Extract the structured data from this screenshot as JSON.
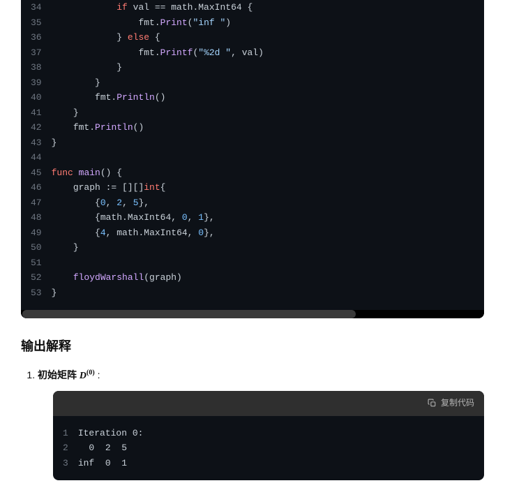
{
  "codeBlock1": {
    "startLine": 34,
    "lines": [
      {
        "i": "            ",
        "seg": [
          {
            "t": "if",
            "c": "kw"
          },
          {
            "t": " val == math.MaxInt64 {",
            "c": "ident"
          }
        ]
      },
      {
        "i": "                ",
        "seg": [
          {
            "t": "fmt.",
            "c": "ident"
          },
          {
            "t": "Print",
            "c": "fn"
          },
          {
            "t": "(",
            "c": "punct"
          },
          {
            "t": "\"inf \"",
            "c": "str"
          },
          {
            "t": ")",
            "c": "punct"
          }
        ]
      },
      {
        "i": "            ",
        "seg": [
          {
            "t": "} ",
            "c": "ident"
          },
          {
            "t": "else",
            "c": "kw"
          },
          {
            "t": " {",
            "c": "ident"
          }
        ]
      },
      {
        "i": "                ",
        "seg": [
          {
            "t": "fmt.",
            "c": "ident"
          },
          {
            "t": "Printf",
            "c": "fn"
          },
          {
            "t": "(",
            "c": "punct"
          },
          {
            "t": "\"%2d \"",
            "c": "str"
          },
          {
            "t": ", val)",
            "c": "ident"
          }
        ]
      },
      {
        "i": "            ",
        "seg": [
          {
            "t": "}",
            "c": "ident"
          }
        ]
      },
      {
        "i": "        ",
        "seg": [
          {
            "t": "}",
            "c": "ident"
          }
        ]
      },
      {
        "i": "        ",
        "seg": [
          {
            "t": "fmt.",
            "c": "ident"
          },
          {
            "t": "Println",
            "c": "fn"
          },
          {
            "t": "()",
            "c": "punct"
          }
        ]
      },
      {
        "i": "    ",
        "seg": [
          {
            "t": "}",
            "c": "ident"
          }
        ]
      },
      {
        "i": "    ",
        "seg": [
          {
            "t": "fmt.",
            "c": "ident"
          },
          {
            "t": "Println",
            "c": "fn"
          },
          {
            "t": "()",
            "c": "punct"
          }
        ]
      },
      {
        "i": "",
        "seg": [
          {
            "t": "}",
            "c": "ident"
          }
        ]
      },
      {
        "i": "",
        "seg": []
      },
      {
        "i": "",
        "seg": [
          {
            "t": "func",
            "c": "kw"
          },
          {
            "t": " ",
            "c": "ident"
          },
          {
            "t": "main",
            "c": "fn"
          },
          {
            "t": "() {",
            "c": "punct"
          }
        ]
      },
      {
        "i": "    ",
        "seg": [
          {
            "t": "graph := [][]",
            "c": "ident"
          },
          {
            "t": "int",
            "c": "type"
          },
          {
            "t": "{",
            "c": "punct"
          }
        ]
      },
      {
        "i": "        ",
        "seg": [
          {
            "t": "{",
            "c": "punct"
          },
          {
            "t": "0",
            "c": "num"
          },
          {
            "t": ", ",
            "c": "punct"
          },
          {
            "t": "2",
            "c": "num"
          },
          {
            "t": ", ",
            "c": "punct"
          },
          {
            "t": "5",
            "c": "num"
          },
          {
            "t": "},",
            "c": "punct"
          }
        ]
      },
      {
        "i": "        ",
        "seg": [
          {
            "t": "{math.MaxInt64, ",
            "c": "ident"
          },
          {
            "t": "0",
            "c": "num"
          },
          {
            "t": ", ",
            "c": "punct"
          },
          {
            "t": "1",
            "c": "num"
          },
          {
            "t": "},",
            "c": "punct"
          }
        ]
      },
      {
        "i": "        ",
        "seg": [
          {
            "t": "{",
            "c": "punct"
          },
          {
            "t": "4",
            "c": "num"
          },
          {
            "t": ", math.MaxInt64, ",
            "c": "ident"
          },
          {
            "t": "0",
            "c": "num"
          },
          {
            "t": "},",
            "c": "punct"
          }
        ]
      },
      {
        "i": "    ",
        "seg": [
          {
            "t": "}",
            "c": "ident"
          }
        ]
      },
      {
        "i": "",
        "seg": []
      },
      {
        "i": "    ",
        "seg": [
          {
            "t": "floydWarshall",
            "c": "fn"
          },
          {
            "t": "(graph)",
            "c": "ident"
          }
        ]
      },
      {
        "i": "",
        "seg": [
          {
            "t": "}",
            "c": "ident"
          }
        ]
      }
    ]
  },
  "sectionTitle": "输出解释",
  "listItem1": {
    "prefix": "初始矩阵 ",
    "math": "D",
    "mathSup": "(0)",
    "suffix": ":"
  },
  "copyLabel": "复制代码",
  "codeBlock2": {
    "startLine": 1,
    "lines": [
      {
        "i": "",
        "seg": [
          {
            "t": "Iteration 0:",
            "c": "ident"
          }
        ]
      },
      {
        "i": "",
        "seg": [
          {
            "t": "  0  2  5",
            "c": "ident"
          }
        ]
      },
      {
        "i": "",
        "seg": [
          {
            "t": "inf  0  1",
            "c": "ident"
          }
        ]
      }
    ]
  }
}
